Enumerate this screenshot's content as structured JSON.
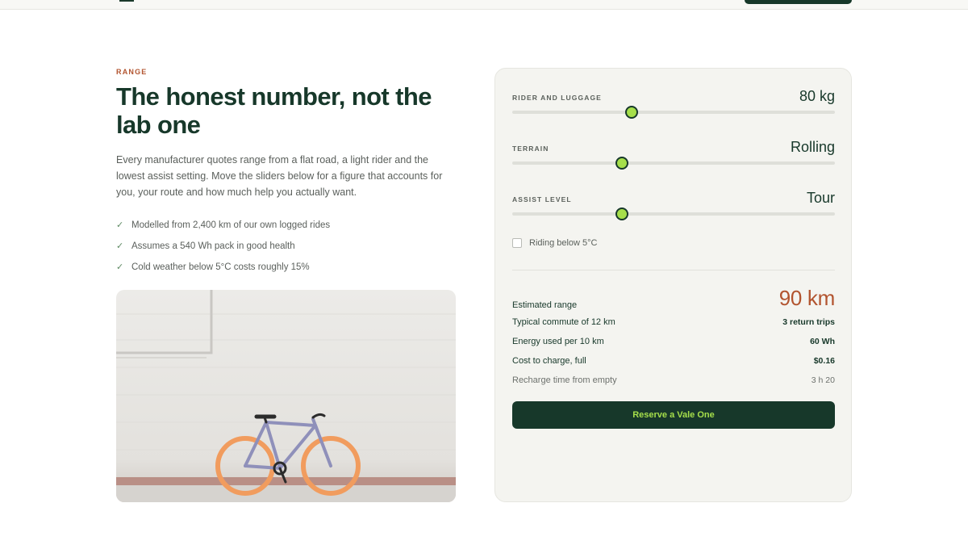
{
  "section": {
    "eyebrow": "RANGE",
    "headline": "The honest number, not the lab one",
    "lead": "Every manufacturer quotes range from a flat road, a light rider and the lowest assist setting. Move the sliders below for a figure that accounts for you, your route and how much help you actually want.",
    "checks": [
      "Modelled from 2,400 km of our own logged rides",
      "Assumes a 540 Wh pack in good health",
      "Cold weather below 5°C costs roughly 15%"
    ]
  },
  "calculator": {
    "sliders": [
      {
        "label": "RIDER AND LUGGAGE",
        "value": "80 kg",
        "level": 0.37
      },
      {
        "label": "TERRAIN",
        "value": "Rolling",
        "level": 0.34
      },
      {
        "label": "ASSIST LEVEL",
        "value": "Tour",
        "level": 0.34
      }
    ],
    "cold_checkbox": {
      "label": "Riding below 5°C",
      "checked": false
    },
    "estimate": {
      "label": "Estimated range",
      "value": "90 km"
    },
    "results": [
      {
        "label": "Typical commute of 12 km",
        "value": "3 return trips"
      },
      {
        "label": "Energy used per 10 km",
        "value": "60 Wh"
      },
      {
        "label": "Cost to charge, full",
        "value": "$0.16"
      },
      {
        "label": "Recharge time from empty",
        "value": "3 h 20"
      }
    ],
    "cta_label": "Reserve a Vale One"
  },
  "colors": {
    "brand_dark": "#17382a",
    "accent_lime": "#a6df4b",
    "accent_rust": "#b2542f"
  }
}
